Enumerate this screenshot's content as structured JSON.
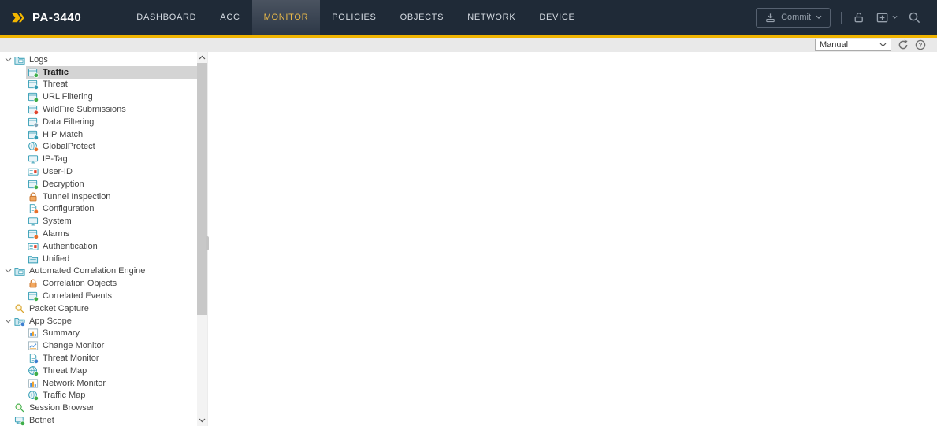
{
  "app": {
    "device_name": "PA-3440"
  },
  "colors": {
    "accent_yellow": "#f0b400",
    "topnav_bg": "#1f2a37",
    "active_tab_text": "#e9b949",
    "selected_row_bg": "#d4d4d4",
    "tree_icon_teal": "#2f9bb3"
  },
  "topnav": {
    "items": [
      {
        "id": "dashboard",
        "label": "DASHBOARD",
        "active": false
      },
      {
        "id": "acc",
        "label": "ACC",
        "active": false
      },
      {
        "id": "monitor",
        "label": "MONITOR",
        "active": true
      },
      {
        "id": "policies",
        "label": "POLICIES",
        "active": false
      },
      {
        "id": "objects",
        "label": "OBJECTS",
        "active": false
      },
      {
        "id": "network",
        "label": "NETWORK",
        "active": false
      },
      {
        "id": "device",
        "label": "DEVICE",
        "active": false
      }
    ],
    "commit": {
      "label": "Commit",
      "icon": "commit-arrow-tray-icon",
      "has_dropdown": true
    },
    "action_icons": [
      {
        "name": "unlocked-padlock-icon"
      },
      {
        "name": "config-audit-icon",
        "has_dropdown": true
      },
      {
        "name": "search-icon"
      }
    ]
  },
  "toolbar": {
    "refresh_select": {
      "value": "Manual"
    },
    "icons": [
      {
        "name": "refresh-icon"
      },
      {
        "name": "help-icon"
      }
    ]
  },
  "sidebar": {
    "tree": [
      {
        "slug": "logs",
        "label": "Logs",
        "level": 0,
        "kind": "folder",
        "expanded": true
      },
      {
        "slug": "traffic",
        "label": "Traffic",
        "level": 1,
        "kind": "table",
        "badge": "#3fae4a",
        "selected": true
      },
      {
        "slug": "threat",
        "label": "Threat",
        "level": 1,
        "kind": "table",
        "badge": "#2f9bb3"
      },
      {
        "slug": "url-filtering",
        "label": "URL Filtering",
        "level": 1,
        "kind": "table",
        "badge": "#3fae4a"
      },
      {
        "slug": "wildfire-submissions",
        "label": "WildFire Submissions",
        "level": 1,
        "kind": "table",
        "badge": "#e0452f"
      },
      {
        "slug": "data-filtering",
        "label": "Data Filtering",
        "level": 1,
        "kind": "table",
        "badge": "#7fa3b5"
      },
      {
        "slug": "hip-match",
        "label": "HIP Match",
        "level": 1,
        "kind": "table",
        "badge": "#2f9bb3"
      },
      {
        "slug": "globalprotect",
        "label": "GlobalProtect",
        "level": 1,
        "kind": "globe",
        "badge": "#e8702a"
      },
      {
        "slug": "ip-tag",
        "label": "IP-Tag",
        "level": 1,
        "kind": "monitor"
      },
      {
        "slug": "user-id",
        "label": "User-ID",
        "level": 1,
        "kind": "card",
        "badge": "#e0452f"
      },
      {
        "slug": "decryption",
        "label": "Decryption",
        "level": 1,
        "kind": "table",
        "badge": "#3fae4a"
      },
      {
        "slug": "tunnel-inspection",
        "label": "Tunnel Inspection",
        "level": 1,
        "kind": "lock"
      },
      {
        "slug": "configuration",
        "label": "Configuration",
        "level": 1,
        "kind": "page",
        "badge": "#e8702a"
      },
      {
        "slug": "system",
        "label": "System",
        "level": 1,
        "kind": "monitor"
      },
      {
        "slug": "alarms",
        "label": "Alarms",
        "level": 1,
        "kind": "table",
        "badge": "#e8702a"
      },
      {
        "slug": "authentication",
        "label": "Authentication",
        "level": 1,
        "kind": "card",
        "badge": "#e0452f"
      },
      {
        "slug": "unified",
        "label": "Unified",
        "level": 1,
        "kind": "folder-sm"
      },
      {
        "slug": "automated-correlation-engine",
        "label": "Automated Correlation Engine",
        "level": 0,
        "kind": "folder",
        "expanded": true
      },
      {
        "slug": "correlation-objects",
        "label": "Correlation Objects",
        "level": 1,
        "kind": "lock"
      },
      {
        "slug": "correlated-events",
        "label": "Correlated Events",
        "level": 1,
        "kind": "table",
        "badge": "#3fae4a"
      },
      {
        "slug": "packet-capture",
        "label": "Packet Capture",
        "level": 0,
        "kind": "magnifier",
        "badge": "#d9a32a"
      },
      {
        "slug": "app-scope",
        "label": "App Scope",
        "level": 0,
        "kind": "folder",
        "badge": "#3c7fd0",
        "expanded": true
      },
      {
        "slug": "summary",
        "label": "Summary",
        "level": 1,
        "kind": "chart-bar"
      },
      {
        "slug": "change-monitor",
        "label": "Change Monitor",
        "level": 1,
        "kind": "chart-line"
      },
      {
        "slug": "threat-monitor",
        "label": "Threat Monitor",
        "level": 1,
        "kind": "page",
        "badge": "#3c7fd0"
      },
      {
        "slug": "threat-map",
        "label": "Threat Map",
        "level": 1,
        "kind": "globe",
        "badge": "#3fae4a"
      },
      {
        "slug": "network-monitor",
        "label": "Network Monitor",
        "level": 1,
        "kind": "chart-bar"
      },
      {
        "slug": "traffic-map",
        "label": "Traffic Map",
        "level": 1,
        "kind": "globe",
        "badge": "#3fae4a"
      },
      {
        "slug": "session-browser",
        "label": "Session Browser",
        "level": 0,
        "kind": "magnifier",
        "badge": "#3fae4a"
      },
      {
        "slug": "botnet",
        "label": "Botnet",
        "level": 0,
        "kind": "computer",
        "badge": "#3fae4a"
      }
    ]
  }
}
